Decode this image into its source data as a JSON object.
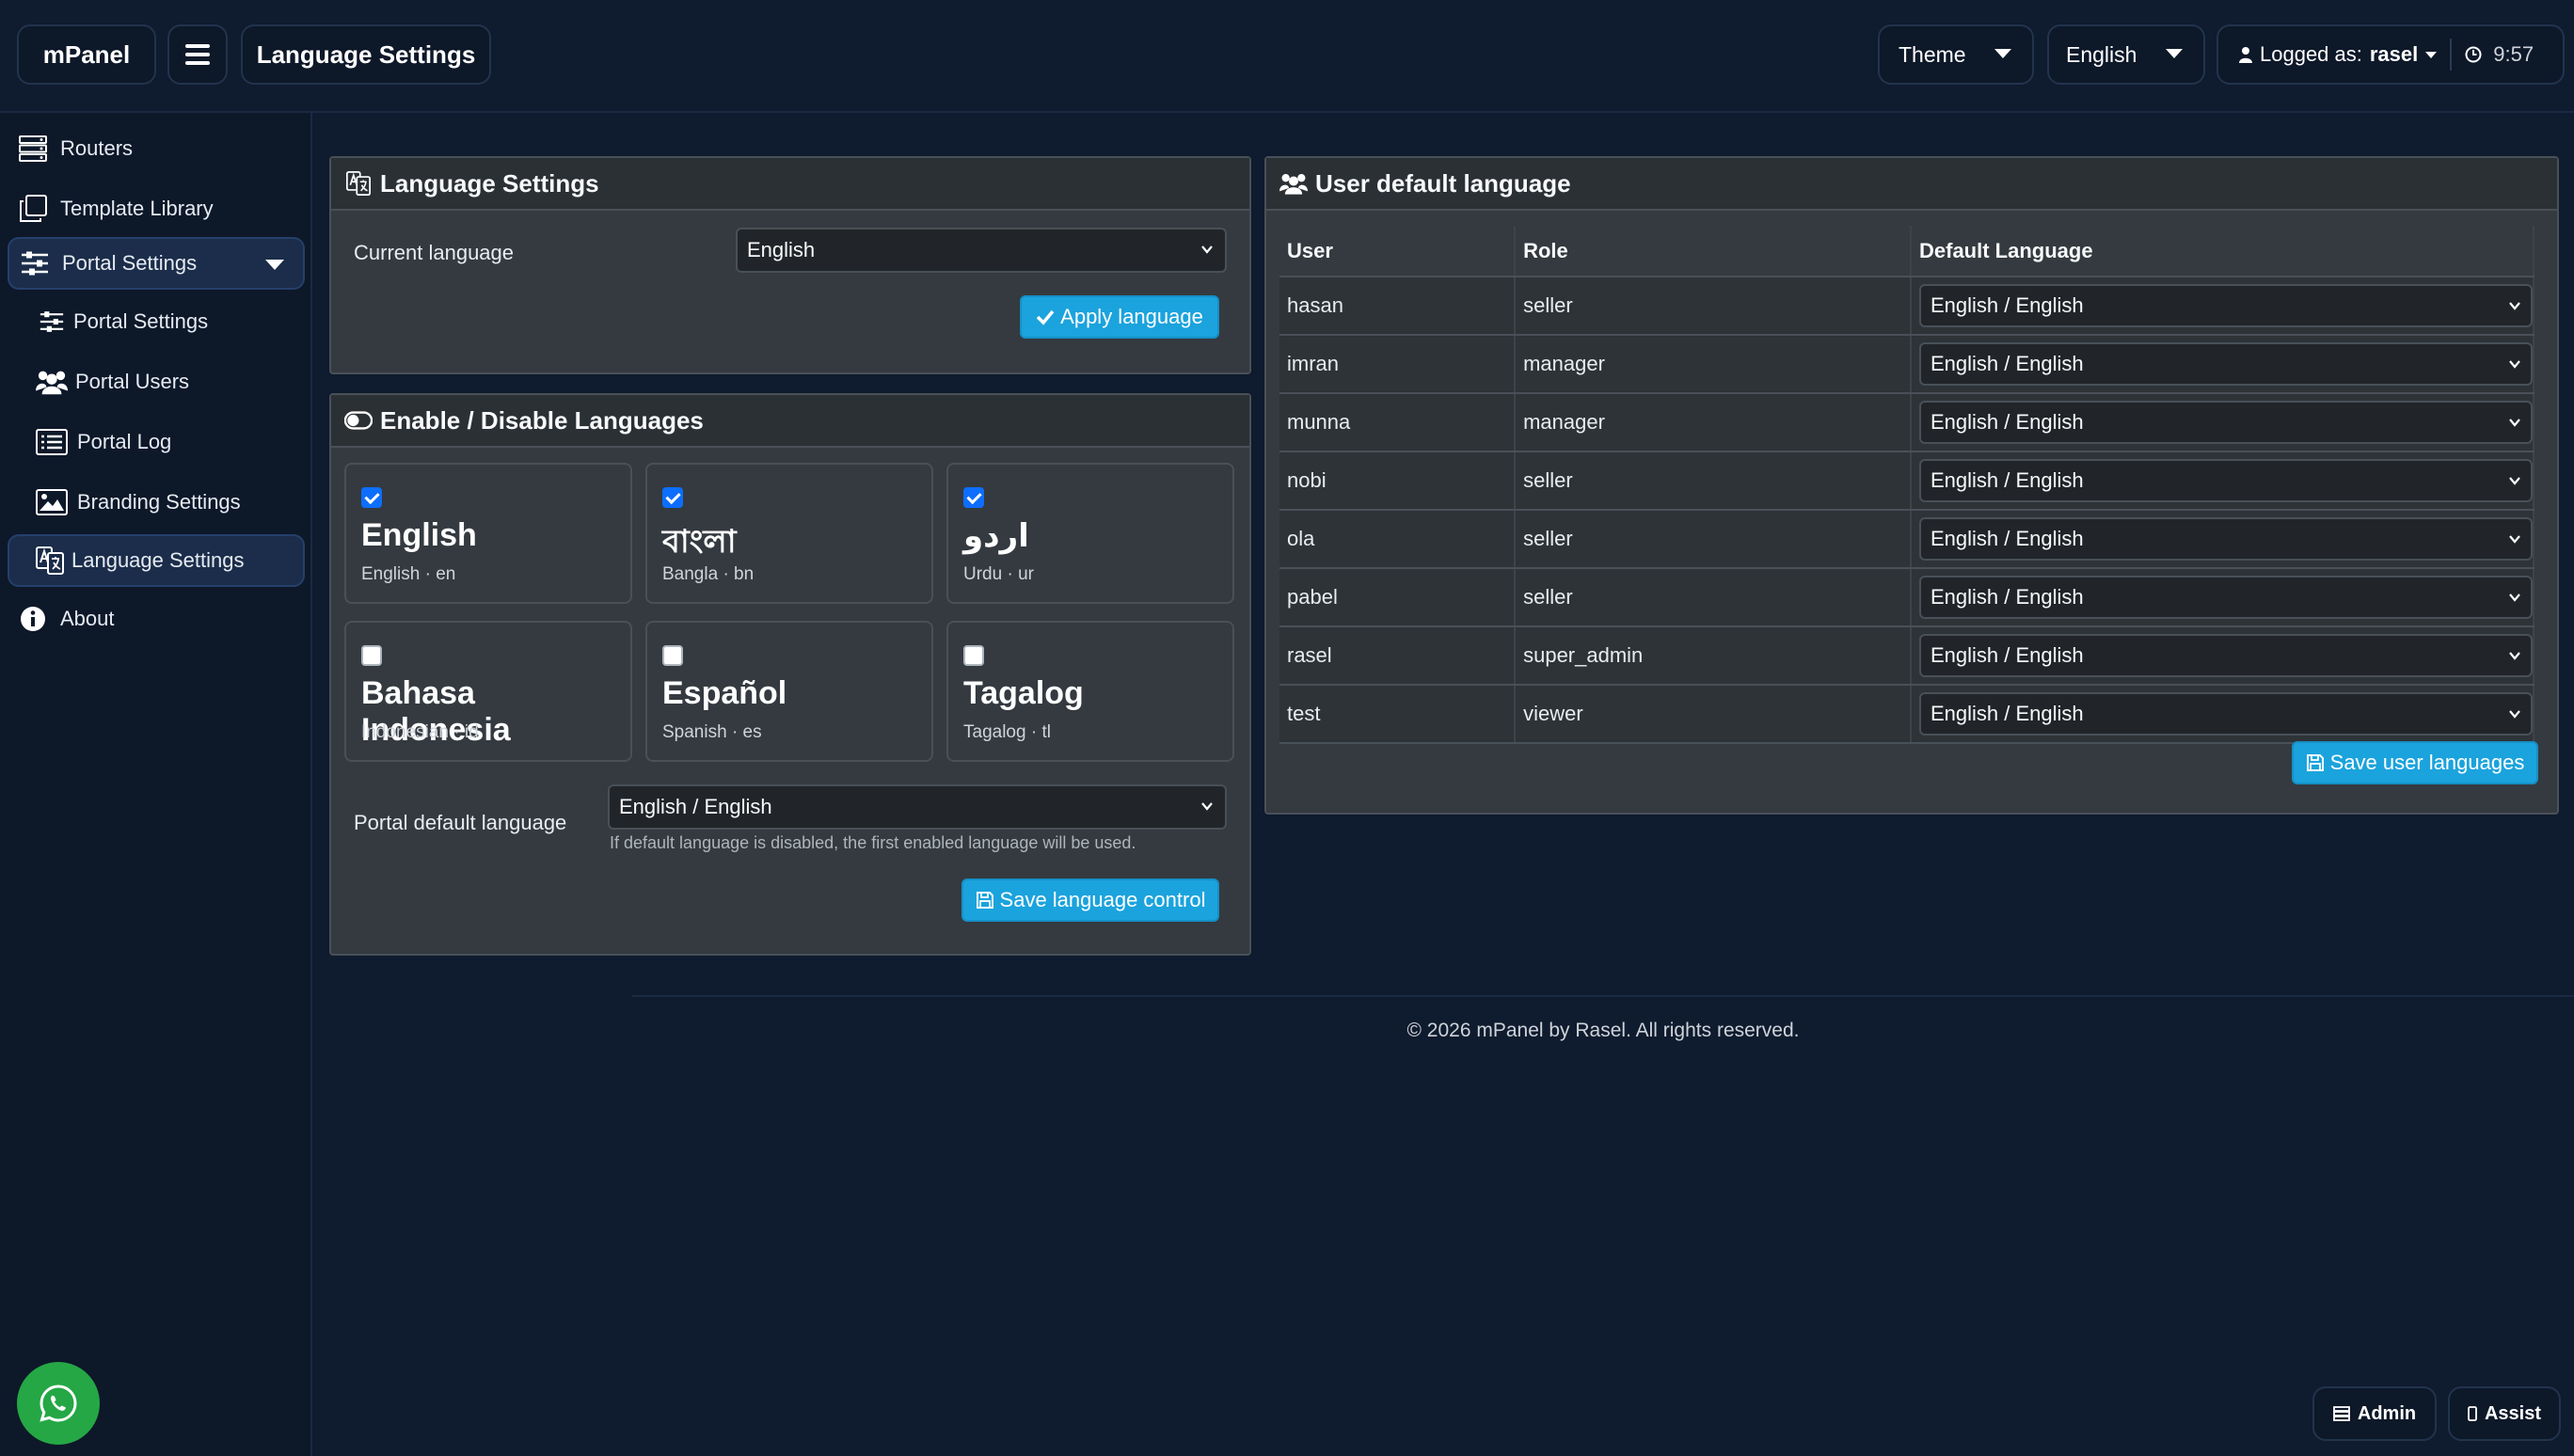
{
  "header": {
    "brand": "mPanel",
    "page_title": "Language Settings",
    "theme_label": "Theme",
    "language_label": "English",
    "logged_as_label": "Logged as:",
    "username": "rasel",
    "time": "9:57"
  },
  "sidebar": {
    "items": [
      {
        "label": "Routers",
        "icon": "server-icon"
      },
      {
        "label": "Template Library",
        "icon": "copy-icon"
      },
      {
        "label": "Portal Settings",
        "icon": "sliders-icon",
        "expanded": true
      },
      {
        "label": "Portal Settings",
        "icon": "sliders-icon"
      },
      {
        "label": "Portal Users",
        "icon": "users-icon"
      },
      {
        "label": "Portal Log",
        "icon": "list-icon"
      },
      {
        "label": "Branding Settings",
        "icon": "image-icon"
      },
      {
        "label": "Language Settings",
        "icon": "language-icon",
        "active": true
      },
      {
        "label": "About",
        "icon": "info-icon"
      }
    ]
  },
  "language_settings": {
    "title": "Language Settings",
    "current_language_label": "Current language",
    "current_language_value": "English",
    "apply_button": "Apply language"
  },
  "enable_disable": {
    "title": "Enable / Disable Languages",
    "languages": [
      {
        "native": "English",
        "code": "English · en",
        "enabled": true
      },
      {
        "native": "বাংলা",
        "code": "Bangla · bn",
        "enabled": true
      },
      {
        "native": "اردو",
        "code": "Urdu · ur",
        "enabled": true
      },
      {
        "native": "Bahasa Indonesia",
        "code": "Indonesian · id",
        "enabled": false
      },
      {
        "native": "Español",
        "code": "Spanish · es",
        "enabled": false
      },
      {
        "native": "Tagalog",
        "code": "Tagalog · tl",
        "enabled": false
      }
    ],
    "default_label": "Portal default language",
    "default_value": "English / English",
    "help": "If default language is disabled, the first enabled language will be used.",
    "save_button": "Save language control"
  },
  "user_default": {
    "title": "User default language",
    "columns": [
      "User",
      "Role",
      "Default Language"
    ],
    "rows": [
      {
        "user": "hasan",
        "role": "seller",
        "lang": "English / English"
      },
      {
        "user": "imran",
        "role": "manager",
        "lang": "English / English"
      },
      {
        "user": "munna",
        "role": "manager",
        "lang": "English / English"
      },
      {
        "user": "nobi",
        "role": "seller",
        "lang": "English / English"
      },
      {
        "user": "ola",
        "role": "seller",
        "lang": "English / English"
      },
      {
        "user": "pabel",
        "role": "seller",
        "lang": "English / English"
      },
      {
        "user": "rasel",
        "role": "super_admin",
        "lang": "English / English"
      },
      {
        "user": "test",
        "role": "viewer",
        "lang": "English / English"
      }
    ],
    "save_button": "Save user languages"
  },
  "footer": "© 2026 mPanel by Rasel. All rights reserved.",
  "corner": {
    "admin": "Admin",
    "assist": "Assist"
  },
  "colors": {
    "accent": "#1ba3dd",
    "background": "#0f1b2e",
    "panel": "#343a40",
    "whatsapp": "#25a745"
  }
}
